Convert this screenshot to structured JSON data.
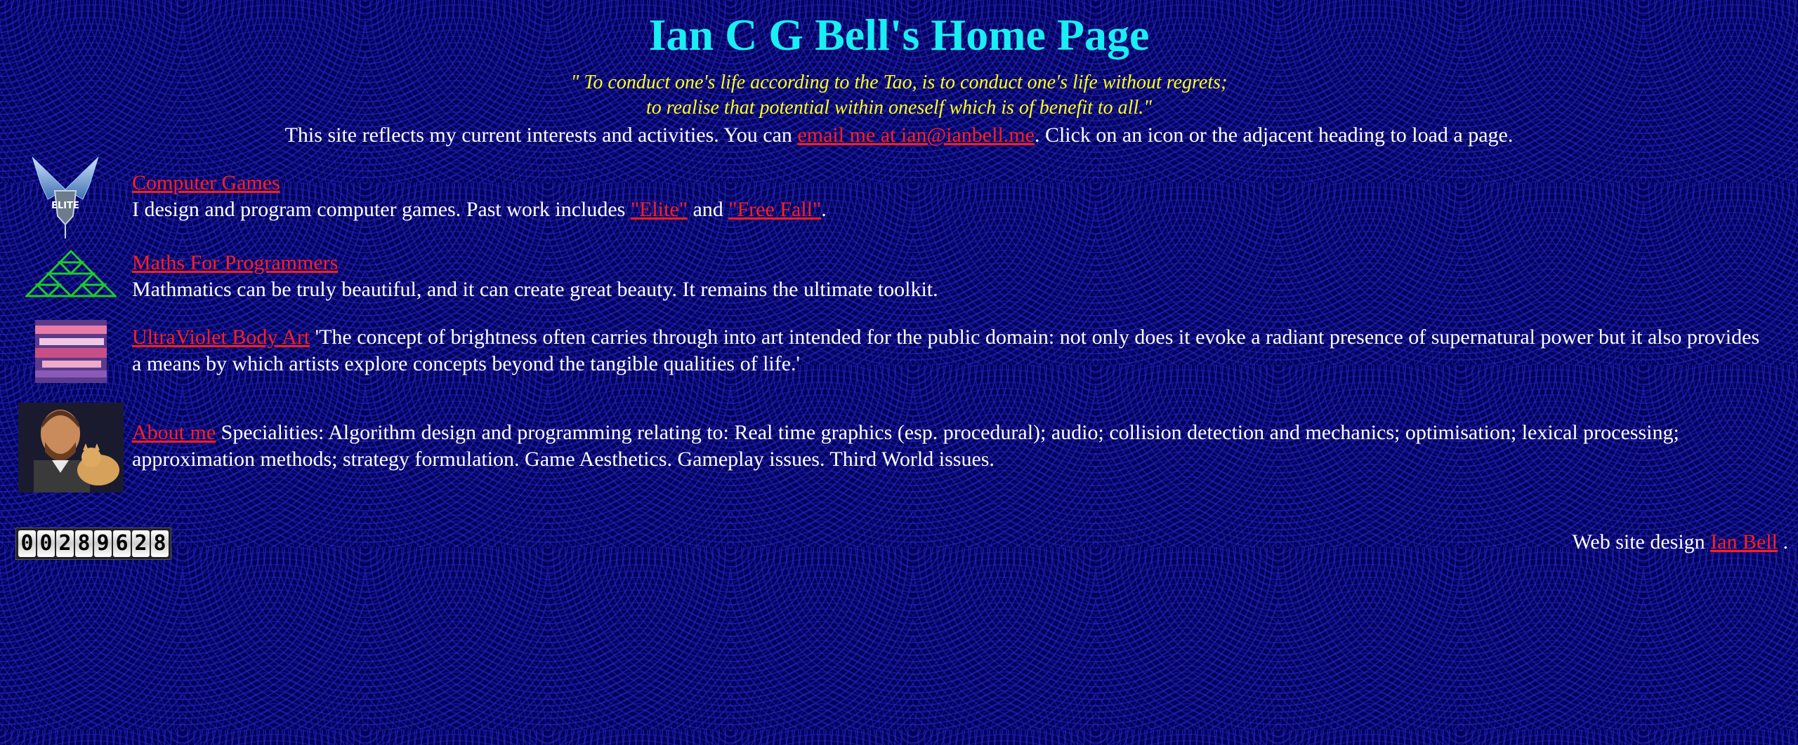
{
  "header": {
    "title": "Ian C G Bell's Home Page",
    "quote_line1": "\" To conduct one's life according to the Tao, is to conduct one's life without regrets;",
    "quote_line2": "to realise that potential within oneself which is of benefit to all.\"",
    "intro_before": "This site reflects my current interests and activities. You can ",
    "intro_link": "email me at ian@ianbell.me",
    "intro_after": ". Click on an icon or the adjacent heading to load a page."
  },
  "sections": [
    {
      "link": "Computer Games",
      "text_before": "I design and program computer games. Past work includes ",
      "link_elite": "\"Elite\"",
      "text_and": " and ",
      "link_freefall": "\"Free Fall\"",
      "text_after": ".",
      "icon": "elite-logo-icon"
    },
    {
      "link": "Maths For Programmers",
      "text": "Mathmatics can be truly beautiful, and it can create great beauty. It remains the ultimate toolkit.",
      "icon": "sierpinski-triangle-icon"
    },
    {
      "link": "UltraViolet Body Art",
      "text": " 'The concept of brightness often carries through into art intended for the public domain: not only does it evoke a radiant presence of supernatural power but it also provides a means by which artists explore concepts beyond the tangible qualities of life.'",
      "icon": "body-art-icon"
    },
    {
      "link": "About me",
      "text": " Specialities: Algorithm design and programming relating to: Real time graphics (esp. procedural); audio; collision detection and mechanics; optimisation; lexical processing; approximation methods; strategy formulation.   Game Aesthetics. Gameplay issues. Third World issues.",
      "icon": "portrait-icon"
    }
  ],
  "counter": {
    "digits": [
      "0",
      "0",
      "2",
      "8",
      "9",
      "6",
      "2",
      "8"
    ]
  },
  "footer": {
    "credit_before": "Web site design ",
    "credit_link": "Ian Bell",
    "credit_after": " ."
  },
  "colors": {
    "background": "#02025a",
    "title": "#19eef2",
    "quote": "#ffff1e",
    "link": "#ff1e1e",
    "text": "#ffffff"
  }
}
